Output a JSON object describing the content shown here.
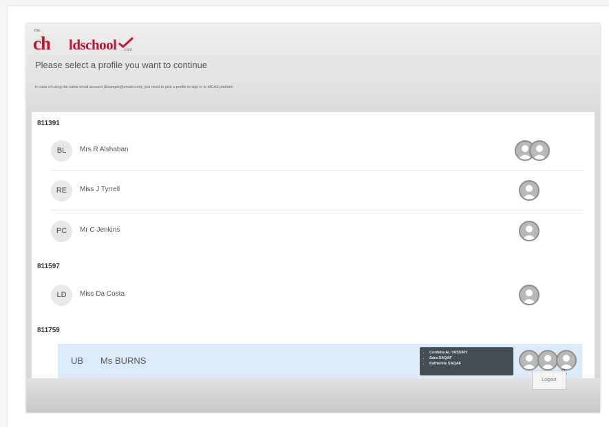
{
  "logo": {
    "top_text": "the",
    "brand_a": "ch",
    "brand_b": "ldschool",
    "suffix": ".com",
    "icon": "checkmark-icon"
  },
  "modal": {
    "title": "Please select a profile you want to continue",
    "note": "In case of using the same email account (Example@email.com), you need to pick a profile to sign in to MCAS platform"
  },
  "groups": [
    {
      "id": "811391",
      "rows": [
        {
          "initials": "BL",
          "name": "Mrs R Alshaban",
          "avatars": 2
        },
        {
          "initials": "RE",
          "name": "Miss J Tyrrell",
          "avatars": 1
        },
        {
          "initials": "PC",
          "name": "Mr C Jenkins",
          "avatars": 1
        }
      ]
    },
    {
      "id": "811597",
      "rows": [
        {
          "initials": "LD",
          "name": "Miss Da Costa",
          "avatars": 1
        }
      ]
    },
    {
      "id": "811759",
      "rows": [
        {
          "initials": "UB",
          "name": "Ms BURNS",
          "avatars": 3,
          "selected": true
        }
      ]
    }
  ],
  "tooltip": {
    "items": [
      "Cordelia AL YASSIRY",
      "Sara SAQAF",
      "Katherine SAQAF"
    ]
  },
  "footer": {
    "logout_label": "Logout"
  },
  "colors": {
    "brand": "#c8102e",
    "selected_row": "#dcebfa",
    "tooltip_bg": "#444c54"
  }
}
